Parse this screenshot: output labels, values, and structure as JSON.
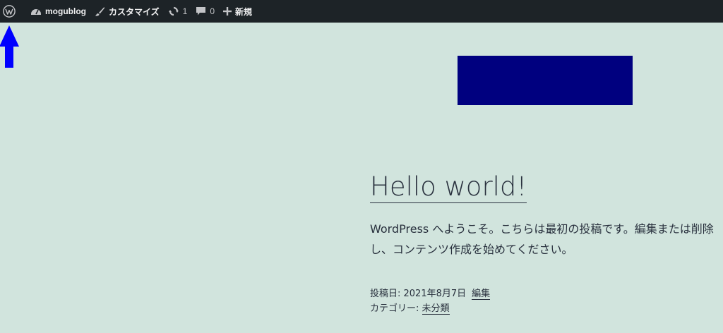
{
  "adminbar": {
    "wp_logo_icon": "wordpress-logo-icon",
    "site_name": "mogublog",
    "customize": "カスタマイズ",
    "updates_count": "1",
    "comments_count": "0",
    "new": "新規",
    "colors": {
      "bg": "#1d2327",
      "text": "#f0f0f1"
    }
  },
  "header": {
    "logo_block_color": "#00007f"
  },
  "annotation": {
    "arrow_color": "#0000ff"
  },
  "post": {
    "title": "Hello world!",
    "content_line1": "WordPress へようこそ。こちらは最初の投稿です。編集または削除",
    "content_line2": "し、コンテンツ作成を始めてください。",
    "posted_label": "投稿日: ",
    "posted_date": "2021年8月7日",
    "edit_link": "編集",
    "category_label": "カテゴリー: ",
    "category": "未分類"
  },
  "page": {
    "background": "#d1e4dd"
  }
}
